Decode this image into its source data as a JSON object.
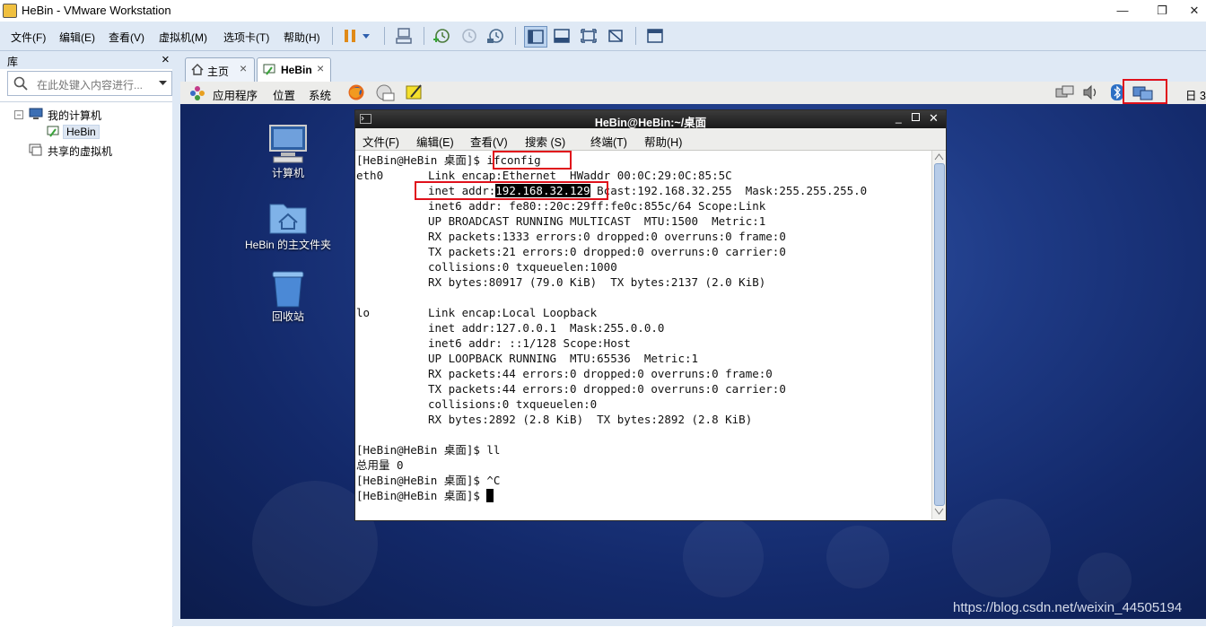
{
  "window": {
    "title": "HeBin - VMware Workstation",
    "minimize": "—",
    "restore": "❐",
    "close": "✕"
  },
  "menubar": {
    "items": [
      "文件(F)",
      "编辑(E)",
      "查看(V)",
      "虚拟机(M)",
      "选项卡(T)",
      "帮助(H)"
    ]
  },
  "library": {
    "title": "库",
    "close": "×",
    "search_placeholder": "在此处键入内容进行...",
    "tree": {
      "my_computer": "我的计算机",
      "vm": "HeBin",
      "shared": "共享的虚拟机"
    }
  },
  "tabs": [
    {
      "label": "主页",
      "close": "×"
    },
    {
      "label": "HeBin",
      "close": "×"
    }
  ],
  "guest_panel": {
    "apps": "应用程序",
    "places": "位置",
    "system": "系统",
    "clock_partial": "日 3"
  },
  "desktop_icons": [
    {
      "label": "计算机"
    },
    {
      "label": "HeBin 的主文件夹"
    },
    {
      "label": "回收站"
    }
  ],
  "terminal": {
    "title": "HeBin@HeBin:~/桌面",
    "menu": [
      "文件(F)",
      "编辑(E)",
      "查看(V)",
      "搜索 (S)",
      "终端(T)",
      "帮助(H)"
    ],
    "prompt1": "[HeBin@HeBin 桌面]$ ",
    "cmd1": "ifconfig",
    "eth0_label": "eth0",
    "eth0_encap": "Link encap:Ethernet  HWaddr 00:0C:29:0C:85:5C",
    "inet_prefix": "inet addr:",
    "ip_address": "192.168.32.129",
    "inet_rest": " Bcast:192.168.32.255  Mask:255.255.255.0",
    "eth0_lines": [
      "inet6 addr: fe80::20c:29ff:fe0c:855c/64 Scope:Link",
      "UP BROADCAST RUNNING MULTICAST  MTU:1500  Metric:1",
      "RX packets:1333 errors:0 dropped:0 overruns:0 frame:0",
      "TX packets:21 errors:0 dropped:0 overruns:0 carrier:0",
      "collisions:0 txqueuelen:1000",
      "RX bytes:80917 (79.0 KiB)  TX bytes:2137 (2.0 KiB)"
    ],
    "lo_label": "lo",
    "lo_lines": [
      "Link encap:Local Loopback",
      "inet addr:127.0.0.1  Mask:255.0.0.0",
      "inet6 addr: ::1/128 Scope:Host",
      "UP LOOPBACK RUNNING  MTU:65536  Metric:1",
      "RX packets:44 errors:0 dropped:0 overruns:0 frame:0",
      "TX packets:44 errors:0 dropped:0 overruns:0 carrier:0",
      "collisions:0 txqueuelen:0",
      "RX bytes:2892 (2.8 KiB)  TX bytes:2892 (2.8 KiB)"
    ],
    "line_ll": "[HeBin@HeBin 桌面]$ ll",
    "line_total": "总用量 0",
    "line_ctrlc": "[HeBin@HeBin 桌面]$ ^C",
    "line_prompt_last": "[HeBin@HeBin 桌面]$ "
  },
  "watermark": "https://blog.csdn.net/weixin_44505194",
  "colors": {
    "highlight": "#e0111b",
    "desktop": "#1e3a85",
    "chrome": "#dfe9f5"
  }
}
